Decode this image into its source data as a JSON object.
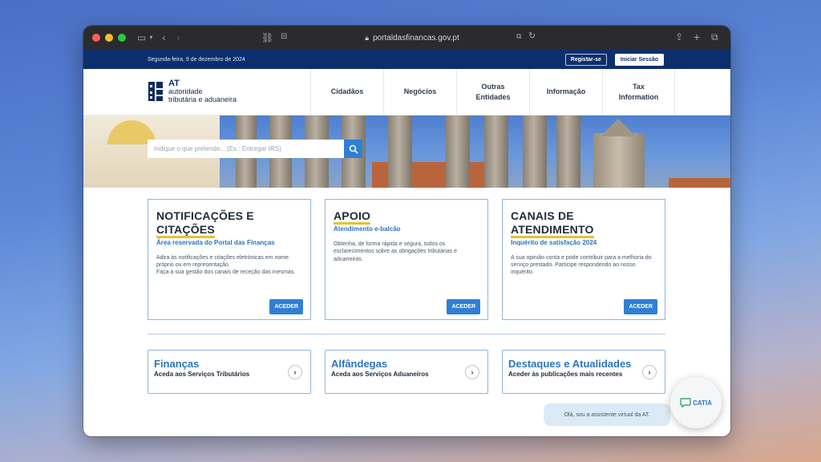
{
  "browser": {
    "url": "portaldasfinancas.gov.pt"
  },
  "topbar": {
    "date": "Segunda-feira, 9 de dezembro de 2024",
    "register_label": "Registar-se",
    "login_label": "Iniciar Sessão"
  },
  "logo": {
    "abbr": "AT",
    "line1": "autoridade",
    "line2": "tributária e aduaneira"
  },
  "nav": {
    "items": [
      {
        "label": "Cidadãos"
      },
      {
        "label": "Negócios"
      },
      {
        "label": "Outras\nEntidades"
      },
      {
        "label": "Informação"
      },
      {
        "label": "Tax\nInformation"
      }
    ]
  },
  "search": {
    "placeholder": "Indique o que pretende... (Ex.: Entregar IRS)"
  },
  "cards": [
    {
      "title_line1": "NOTIFICAÇÕES E",
      "title_line2": "CITAÇÕES",
      "subtitle": "Área reservada do Portal das Finanças",
      "text": "Adira às notificações e citações eletrónicas em nome próprio ou em representação.\nFaça a sua gestão dos canais de receção das mesmas.",
      "button": "ACEDER"
    },
    {
      "title_line1": "APOIO",
      "title_line2": "",
      "subtitle": "Atendimento e-balcão",
      "text": "Obtenha, de forma rápida e segura, todos os esclarecimentos sobre as obrigações tributárias e aduaneiras.",
      "button": "ACEDER"
    },
    {
      "title_line1": "CANAIS DE",
      "title_line2": "ATENDIMENTO",
      "subtitle": "Inquérito de satisfação 2024",
      "text": "A sua opinião conta e pode contribuir para a melhoria do serviço prestado. Participe respondendo ao nosso inquérito.",
      "button": "ACEDER"
    }
  ],
  "links": [
    {
      "title": "Finanças",
      "subtitle": "Aceda aos Serviços Tributários"
    },
    {
      "title": "Alfândegas",
      "subtitle": "Aceda aos Serviços Aduaneiros"
    },
    {
      "title": "Destaques e Atualidades",
      "subtitle": "Aceder às publicações mais recentes"
    }
  ],
  "assistant": {
    "greeting": "Olá, sou a assistente virtual da AT.",
    "name": "CATIA"
  },
  "colors": {
    "brand_navy": "#0d2f6e",
    "accent_blue": "#2f7fd4",
    "underline_yellow": "#e7c32e"
  }
}
